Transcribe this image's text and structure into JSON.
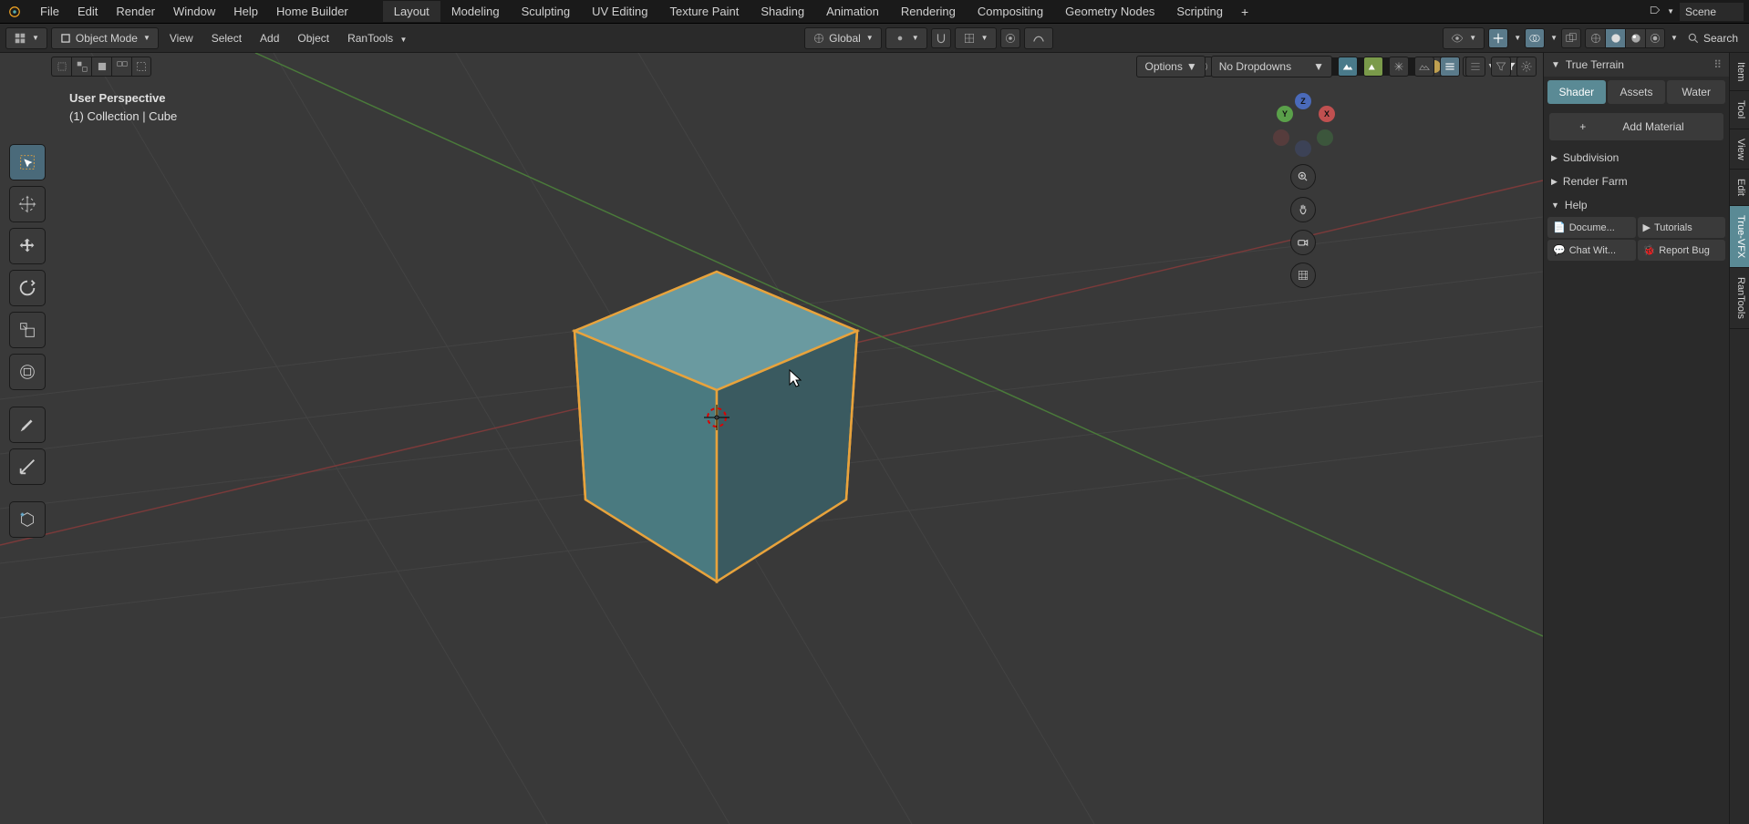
{
  "menubar": {
    "items": [
      "File",
      "Edit",
      "Render",
      "Window",
      "Help",
      "Home Builder"
    ]
  },
  "workspaces": {
    "tabs": [
      "Layout",
      "Modeling",
      "Sculpting",
      "UV Editing",
      "Texture Paint",
      "Shading",
      "Animation",
      "Rendering",
      "Compositing",
      "Geometry Nodes",
      "Scripting"
    ],
    "active": 0
  },
  "scene": {
    "label": "Scene"
  },
  "header": {
    "mode": "Object Mode",
    "view": "View",
    "select": "Select",
    "add": "Add",
    "object": "Object",
    "rantools": "RanTools",
    "orientation": "Global",
    "search_label": "Search"
  },
  "viewport": {
    "perspective": "User Perspective",
    "collection": "(1) Collection | Cube",
    "options_label": "Options",
    "dropdowns_label": "No Dropdowns"
  },
  "nav_axes": {
    "x": "X",
    "y": "Y",
    "z": "Z"
  },
  "right_panel": {
    "title": "True Terrain",
    "tabs": [
      "Shader",
      "Assets",
      "Water"
    ],
    "active_tab": 0,
    "add_material": "Add Material",
    "sections": {
      "subdivision": "Subdivision",
      "render_farm": "Render Farm",
      "help": "Help"
    },
    "help_buttons": {
      "docs": "Docume...",
      "tutorials": "Tutorials",
      "chat": "Chat Wit...",
      "bug": "Report Bug"
    }
  },
  "right_vtabs": [
    "Item",
    "Tool",
    "View",
    "Edit",
    "True-VFX",
    "RanTools"
  ],
  "right_vtabs_active": 4,
  "tools": {
    "names": [
      "select-box",
      "cursor",
      "move",
      "rotate",
      "scale",
      "transform",
      "annotate",
      "measure",
      "add-cube"
    ]
  },
  "colors": {
    "accent": "#5a8a95",
    "outline": "#e8a33c",
    "axis_x": "#aa3b3b",
    "axis_y": "#4a8a3a",
    "axis_z": "#3a5aaa"
  }
}
